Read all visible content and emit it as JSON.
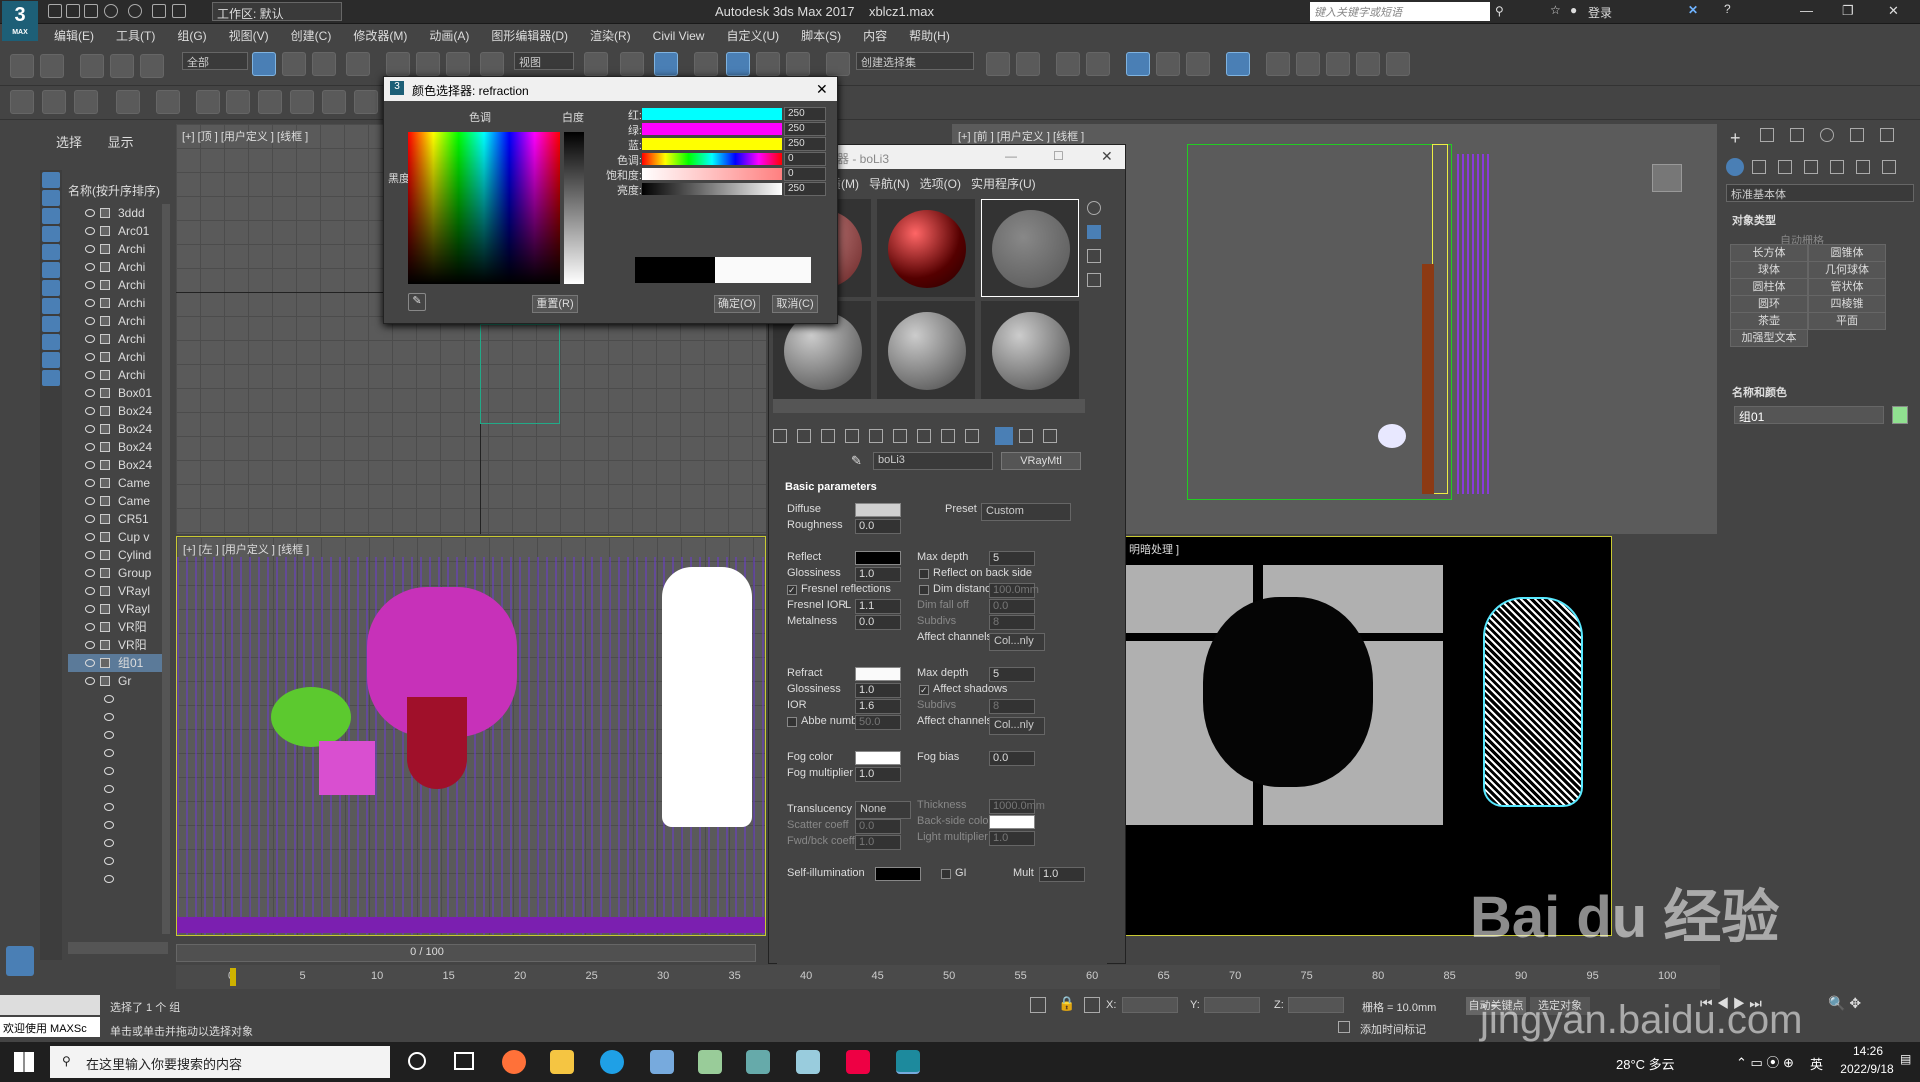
{
  "titlebar": {
    "workspace": "工作区: 默认",
    "app_title": "Autodesk 3ds Max 2017",
    "file_name": "xblcz1.max",
    "search_placeholder": "键入关键字或短语",
    "login": "登录",
    "logo": "MAX"
  },
  "menubar": [
    "编辑(E)",
    "工具(T)",
    "组(G)",
    "视图(V)",
    "创建(C)",
    "修改器(M)",
    "动画(A)",
    "图形编辑器(D)",
    "渲染(R)",
    "Civil View",
    "自定义(U)",
    "脚本(S)",
    "内容",
    "帮助(H)"
  ],
  "toolbar": {
    "filter": "全部",
    "refcoord": "视图",
    "selection_set": "创建选择集"
  },
  "scene_explorer": {
    "tabs": [
      "选择",
      "显示"
    ],
    "header": "名称(按升序排序)",
    "items": [
      "3ddd",
      "Arc01",
      "Archi",
      "Archi",
      "Archi",
      "Archi",
      "Archi",
      "Archi",
      "Archi",
      "Archi",
      "Box01",
      "Box24",
      "Box24",
      "Box24",
      "Box24",
      "Came",
      "Came",
      "CR51",
      "Cup v",
      "Cylind",
      "Group",
      "VRayl",
      "VRayl",
      "VR阳",
      "VR阳",
      "组01",
      "Gr"
    ],
    "selected_index": 25
  },
  "viewports": {
    "top": "[+] [顶 ] [用户定义 ] [线框 ]",
    "front": "[+] [前 ] [用户定义 ] [线框 ]",
    "left": "[+] [左 ] [用户定义 ] [线框 ]",
    "persp": "明暗处理 ]",
    "frame_counter": "0 / 100"
  },
  "color_selector": {
    "title": "颜色选择器: refraction",
    "hue_label": "色调",
    "whiteness_label": "白度",
    "blackness_label": "黑度",
    "rows": [
      {
        "label": "红:",
        "value": "250",
        "color": "#00ffff"
      },
      {
        "label": "绿:",
        "value": "250",
        "color": "#ff00ff"
      },
      {
        "label": "蓝:",
        "value": "250",
        "color": "#ffff00"
      },
      {
        "label": "色调:",
        "value": "0",
        "color": "#ff0000"
      },
      {
        "label": "饱和度:",
        "value": "0",
        "color": "#ff8080"
      },
      {
        "label": "亮度:",
        "value": "250",
        "color": "#ffffff"
      }
    ],
    "reset": "重置(R)",
    "ok": "确定(O)",
    "cancel": "取消(C)"
  },
  "material_editor": {
    "title": "器 - boLi3",
    "menu": [
      "质(M)",
      "导航(N)",
      "选项(O)",
      "实用程序(U)"
    ],
    "material_name": "boLi3",
    "material_type": "VRayMtl",
    "section": "Basic parameters",
    "diffuse": {
      "label": "Diffuse",
      "color": "#d0d0d0"
    },
    "roughness": {
      "label": "Roughness",
      "value": "0.0"
    },
    "preset": {
      "label": "Preset",
      "value": "Custom"
    },
    "reflect": {
      "label": "Reflect",
      "color": "#000000",
      "max_depth_label": "Max depth",
      "max_depth": "5"
    },
    "glossiness": {
      "label": "Glossiness",
      "value": "1.0"
    },
    "reflect_back": "Reflect on back side",
    "fresnel": "Fresnel reflections",
    "dim_distance": {
      "label": "Dim distance",
      "value": "100.0mm"
    },
    "fresnel_ior": {
      "label": "Fresnel IOR",
      "lock": "L",
      "value": "1.1"
    },
    "dim_falloff": {
      "label": "Dim fall off",
      "value": "0.0"
    },
    "metalness": {
      "label": "Metalness",
      "value": "0.0"
    },
    "subdivs": {
      "label": "Subdivs",
      "value": "8"
    },
    "affect_channels": {
      "label": "Affect channels",
      "value": "Col...nly"
    },
    "refract": {
      "label": "Refract",
      "color": "#fafafa",
      "max_depth_label": "Max depth",
      "max_depth": "5"
    },
    "r_glossiness": {
      "label": "Glossiness",
      "value": "1.0"
    },
    "affect_shadows": "Affect shadows",
    "ior": {
      "label": "IOR",
      "value": "1.6"
    },
    "r_subdivs": {
      "label": "Subdivs",
      "value": "8"
    },
    "abbe": {
      "label": "Abbe number",
      "value": "50.0"
    },
    "r_affect_channels": {
      "label": "Affect channels",
      "value": "Col...nly"
    },
    "fog_color": {
      "label": "Fog color",
      "color": "#ffffff"
    },
    "fog_bias": {
      "label": "Fog bias",
      "value": "0.0"
    },
    "fog_multiplier": {
      "label": "Fog multiplier",
      "value": "1.0"
    },
    "translucency": {
      "label": "Translucency",
      "value": "None"
    },
    "thickness": {
      "label": "Thickness",
      "value": "1000.0mm"
    },
    "scatter": {
      "label": "Scatter coeff",
      "value": "0.0"
    },
    "backside": {
      "label": "Back-side color",
      "color": "#ffffff"
    },
    "fwd": {
      "label": "Fwd/bck coeff",
      "value": "1.0"
    },
    "light_mult": {
      "label": "Light multiplier",
      "value": "1.0"
    },
    "self_illum": {
      "label": "Self-illumination",
      "color": "#000000",
      "gi": "GI",
      "mult_label": "Mult",
      "mult": "1.0"
    }
  },
  "command_panel": {
    "category": "标准基本体",
    "object_type": "对象类型",
    "autogrid": "自动栅格",
    "buttons": [
      "长方体",
      "圆锥体",
      "球体",
      "几何球体",
      "圆柱体",
      "管状体",
      "圆环",
      "四棱锥",
      "茶壶",
      "平面",
      "加强型文本"
    ],
    "name_color": "名称和颜色",
    "object_name": "组01",
    "object_color": "#90e090"
  },
  "timeline": {
    "ticks": [
      "0",
      "5",
      "10",
      "15",
      "20",
      "25",
      "30",
      "35",
      "40",
      "45",
      "50",
      "55",
      "60",
      "65",
      "70",
      "75",
      "80",
      "85",
      "90",
      "95",
      "100"
    ]
  },
  "status": {
    "welcome": "欢迎使用 MAXSc",
    "selected": "选择了 1 个 组",
    "hint": "单击或单击并拖动以选择对象",
    "x_label": "X:",
    "y_label": "Y:",
    "z_label": "Z:",
    "grid": "栅格 = 10.0mm",
    "add_tag": "添加时间标记",
    "auto_key": "自动关键点",
    "set_key": "选定对象"
  },
  "taskbar": {
    "search_placeholder": "在这里输入你要搜索的内容",
    "weather": "28°C 多云",
    "ime": "英",
    "time": "14:26",
    "date": "2022/9/18"
  },
  "watermark": {
    "brand": "Bai du 经验",
    "url": "jingyan.baidu.com"
  }
}
